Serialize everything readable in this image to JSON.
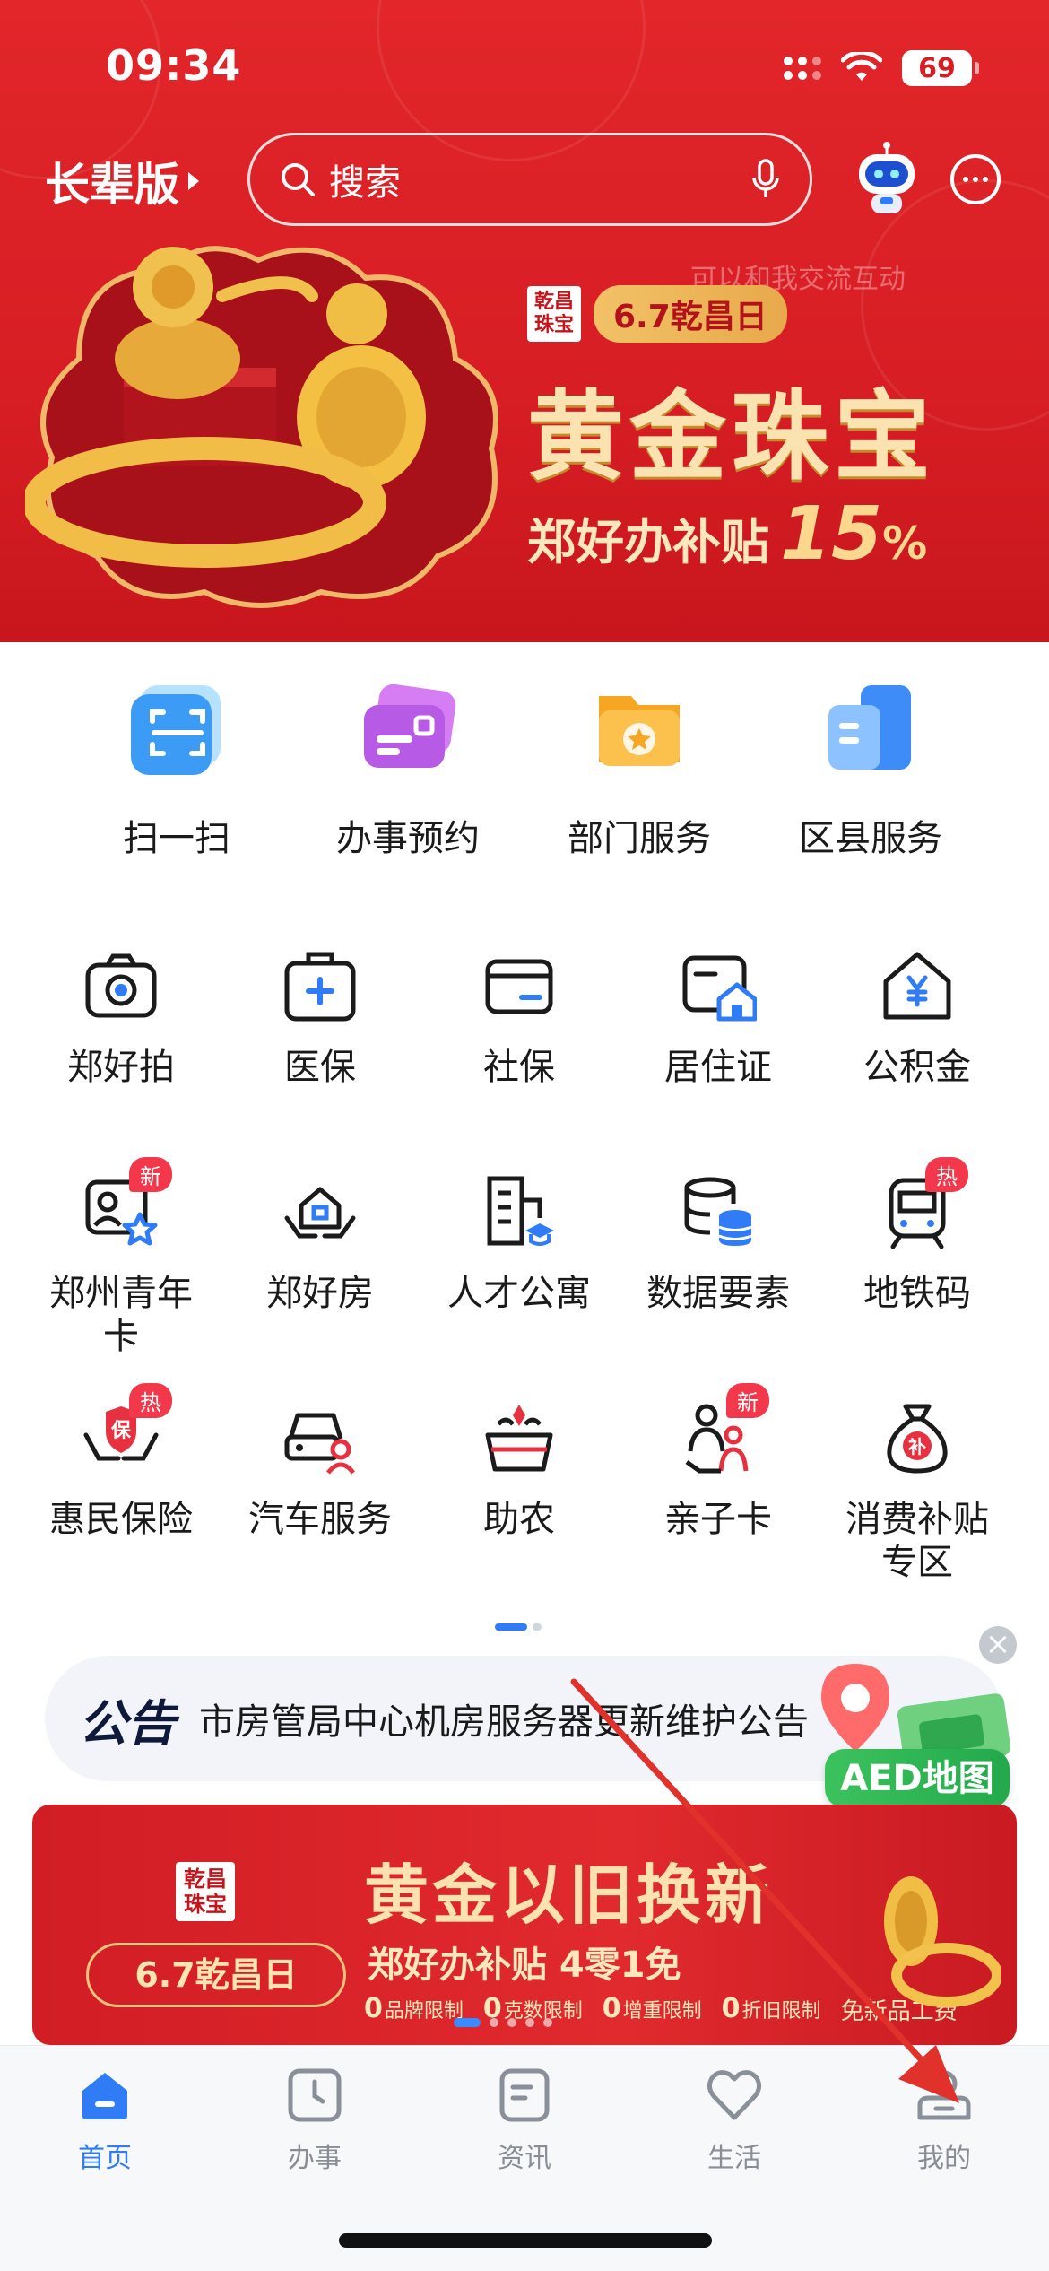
{
  "status_bar": {
    "time": "09:34",
    "battery": "69"
  },
  "header": {
    "senior_mode": "长辈版",
    "search_placeholder": "搜索",
    "robot_hint": "可以和我交流互动"
  },
  "top_banner": {
    "brand_logo": "乾昌珠宝",
    "brand_pill": "6.7乾昌日",
    "title": "黄金珠宝",
    "subtitle": "郑好办补贴",
    "percent_number": "15",
    "percent_sign": "%"
  },
  "quick_services": [
    {
      "label": "扫一扫",
      "icon": "scan-icon"
    },
    {
      "label": "办事预约",
      "icon": "appointment-card-icon"
    },
    {
      "label": "部门服务",
      "icon": "department-folder-icon"
    },
    {
      "label": "区县服务",
      "icon": "district-building-icon"
    }
  ],
  "grid_services": [
    {
      "label": "郑好拍",
      "icon": "camera-icon",
      "badge": ""
    },
    {
      "label": "医保",
      "icon": "medical-kit-icon",
      "badge": ""
    },
    {
      "label": "社保",
      "icon": "social-security-card-icon",
      "badge": ""
    },
    {
      "label": "居住证",
      "icon": "residence-permit-icon",
      "badge": ""
    },
    {
      "label": "公积金",
      "icon": "housing-fund-icon",
      "badge": ""
    },
    {
      "label": "郑州青年卡",
      "icon": "youth-card-icon",
      "badge": "新"
    },
    {
      "label": "郑好房",
      "icon": "house-hands-icon",
      "badge": ""
    },
    {
      "label": "人才公寓",
      "icon": "talent-apartment-icon",
      "badge": ""
    },
    {
      "label": "数据要素",
      "icon": "database-icon",
      "badge": ""
    },
    {
      "label": "地铁码",
      "icon": "metro-icon",
      "badge": "热"
    },
    {
      "label": "惠民保险",
      "icon": "insurance-hands-icon",
      "badge": "热"
    },
    {
      "label": "汽车服务",
      "icon": "car-service-icon",
      "badge": ""
    },
    {
      "label": "助农",
      "icon": "farm-basket-icon",
      "badge": ""
    },
    {
      "label": "亲子卡",
      "icon": "parent-child-icon",
      "badge": "新"
    },
    {
      "label": "消费补贴专区",
      "icon": "subsidy-bag-icon",
      "badge": ""
    }
  ],
  "notice": {
    "tag": "公告",
    "text": "市房管局中心机房服务器更新维护公告"
  },
  "aed": {
    "label": "AED地图"
  },
  "promo_banner": {
    "brand_logo": "乾昌珠宝",
    "pill": "6.7乾昌日",
    "title": "黄金以旧换新",
    "subtitle": "郑好办补贴 4零1免",
    "terms": [
      {
        "num": "0",
        "text": "品牌限制"
      },
      {
        "num": "0",
        "text": "克数限制"
      },
      {
        "num": "0",
        "text": "增重限制"
      },
      {
        "num": "0",
        "text": "折旧限制"
      },
      {
        "num": "",
        "text": "免新品工费"
      }
    ]
  },
  "tabbar": [
    {
      "label": "首页",
      "icon": "home-icon",
      "active": true
    },
    {
      "label": "办事",
      "icon": "clock-icon",
      "active": false
    },
    {
      "label": "资讯",
      "icon": "news-icon",
      "active": false
    },
    {
      "label": "生活",
      "icon": "heart-icon",
      "active": false
    },
    {
      "label": "我的",
      "icon": "profile-icon",
      "active": false
    }
  ],
  "colors": {
    "brand_red": "#d71e24",
    "accent_blue": "#2f7cf6",
    "badge_red": "#f4384c",
    "gold": "#fbe3b1"
  }
}
